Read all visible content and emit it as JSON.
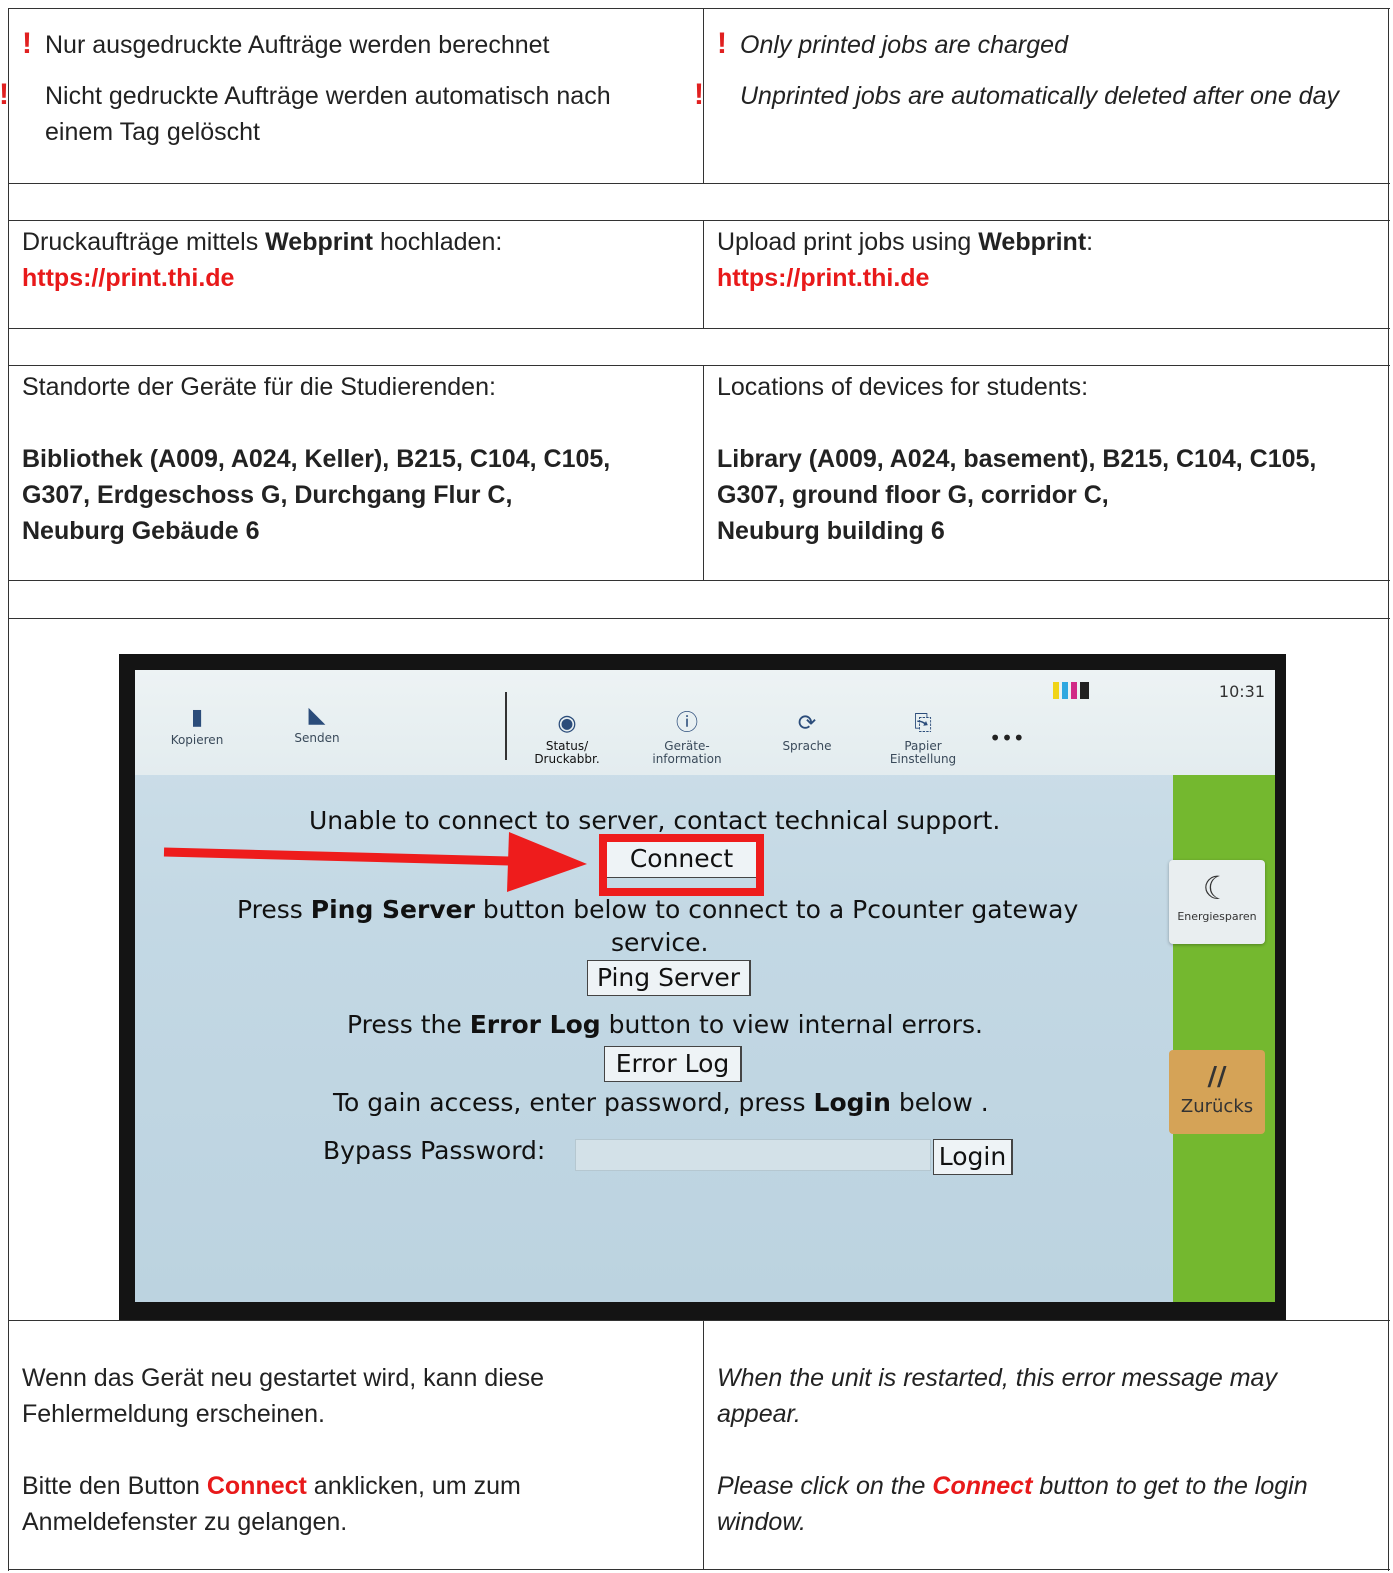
{
  "notices": {
    "de": [
      "Nur ausgedruckte Aufträge werden berechnet",
      "Nicht gedruckte Aufträge werden automatisch nach einem Tag gelöscht"
    ],
    "en": [
      "Only printed jobs are charged",
      "Unprinted jobs are automatically deleted after one day"
    ],
    "mark": "!"
  },
  "upload": {
    "de": {
      "pre": "Druckaufträge mittels ",
      "bold": "Webprint",
      "post": " hochladen:"
    },
    "en": {
      "pre": "Upload print jobs using ",
      "bold": "Webprint",
      "post": ":"
    },
    "url": "https://print.thi.de"
  },
  "locations": {
    "de": {
      "heading": "Standorte der Geräte für die Studierenden:",
      "lines": [
        "Bibliothek (A009, A024, Keller), B215, C104, C105,",
        "G307, Erdgeschoss G, Durchgang Flur C,",
        "Neuburg Gebäude 6"
      ]
    },
    "en": {
      "heading": "Locations of devices for students:",
      "lines": [
        "Library (A009, A024, basement), B215, C104, C105,",
        "G307, ground floor G, corridor C,",
        "Neuburg building 6"
      ]
    }
  },
  "device_screen": {
    "time": "10:31",
    "toolbar": {
      "copy": "Kopieren",
      "send": "Senden",
      "status_1": "Status/",
      "status_2": "Druckabbr.",
      "info_1": "Geräte-",
      "info_2": "information",
      "language": "Sprache",
      "paper_1": "Papier",
      "paper_2": "Einstellung",
      "more": "•••"
    },
    "message_unable": "Unable to connect to server, contact technical support.",
    "connect_button": "Connect",
    "ping_pre": "Press ",
    "ping_bold": "Ping Server",
    "ping_post": " button below to connect to a Pcounter gateway",
    "ping_line2": "service.",
    "ping_button": "Ping Server",
    "error_pre": "Press the ",
    "error_bold": "Error Log",
    "error_post": " button to view internal errors.",
    "error_button": "Error Log",
    "access_pre": "To gain access, enter password, press ",
    "access_bold": "Login",
    "access_post": " below .",
    "bypass_label": "Bypass Password:",
    "password_value": "",
    "login_button": "Login",
    "energy_label": "Energiesparen",
    "back_label": "Zurücks",
    "colors": {
      "sidebar": "#74b82f",
      "highlight": "#ee1c1c"
    }
  },
  "restart": {
    "de": {
      "line1": "Wenn das Gerät neu gestartet wird, kann diese Fehlermeldung erscheinen.",
      "click_pre": "Bitte den Button ",
      "click_bold": "Connect",
      "click_post": " anklicken, um zum Anmeldefenster zu gelangen."
    },
    "en": {
      "line1": "When the unit is restarted, this error message may appear.",
      "click_pre": "Please click on the ",
      "click_bold": "Connect",
      "click_post": " button to get to the login window."
    }
  }
}
